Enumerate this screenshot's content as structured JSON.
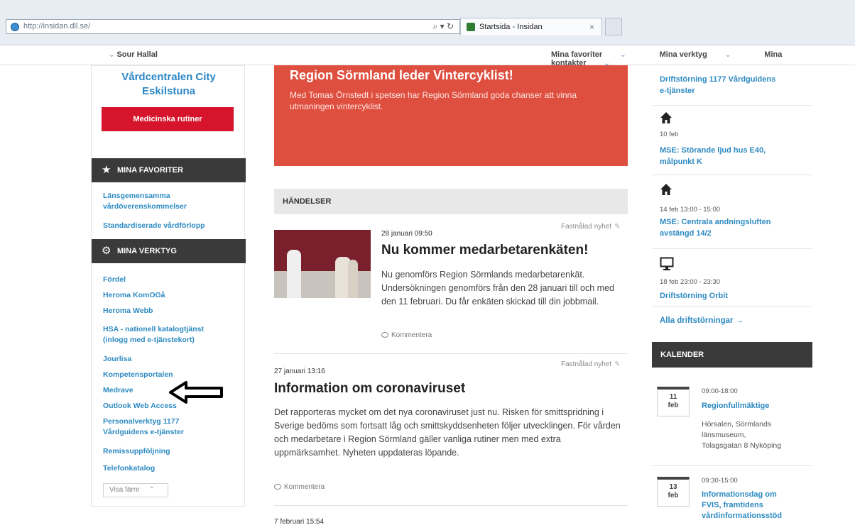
{
  "browser": {
    "url": "http://insidan.dll.se/",
    "tab_title": "Startsida - Insidan",
    "tab_close": "×",
    "address_controls": "⌕ ▾ ↻"
  },
  "topnav": {
    "user": "Sour Hallal",
    "favorites": "Mina favoriter",
    "tools": "Mina verktyg",
    "contacts": "Mina kontakter"
  },
  "left": {
    "unit_title_line1": "Vårdcentralen City",
    "unit_title_line2": "Eskilstuna",
    "red_button": "Medicinska rutiner",
    "favorites_head": "MINA FAVORITER",
    "favorites": [
      "Länsgemensamma",
      "vårdöverenskommelser",
      "Standardiserade vårdförlopp"
    ],
    "tools_head": "MINA VERKTYG",
    "tools": [
      "Fördel",
      "Heroma KomOGå",
      "Heroma Webb",
      "HSA - nationell katalogtjänst",
      "(inlogg med e-tjänstekort)",
      "Jourlisa",
      "Kompetensportalen",
      "Medrave",
      "Outlook Web Access",
      "Personalverktyg 1177",
      "Vårdguidens e-tjänster",
      "Remissuppföljning",
      "Telefonkatalog"
    ],
    "show_less": "Visa färre"
  },
  "banner": {
    "title": "Region Sörmland leder Vintercyklist!",
    "text": "Med Tomas Örnstedt i spetsen har Region Sörmland goda chanser att vinna utmaningen vintercyklist."
  },
  "events": {
    "heading": "HÄNDELSER",
    "pinned_label": "Fastnålad nyhet",
    "comment_label": "Kommentera",
    "items": [
      {
        "date": "28 januari 09:50",
        "title": "Nu kommer medarbetarenkäten!",
        "body": "Nu genomförs Region Sörmlands medarbetarenkät. Undersökningen genomförs från den 28 januari till och med den 11 februari. Du får enkäten skickad till din jobbmail."
      },
      {
        "date": "27 januari 13:16",
        "title": "Information om coronaviruset",
        "body": "Det rapporteras mycket om det nya coronaviruset just nu. Risken för smittspridning i Sverige bedöms som fortsatt låg och smittskyddsenheten följer utvecklingen. För vården och medarbetare i Region Sörmland gäller vanliga rutiner men med extra uppmärksamhet. Nyheten uppdateras löpande."
      },
      {
        "date": "7 februari 15:54"
      }
    ]
  },
  "right": {
    "top_link": "Driftstörning 1177 Vårdguidens",
    "top_link2": "e-tjänster",
    "items": [
      {
        "icon": "home-icon",
        "date": "10 feb",
        "title1": "MSE: Störande ljud hus E40,",
        "title2": "målpunkt K"
      },
      {
        "icon": "home-icon",
        "date": "14 feb 13:00 - 15:00",
        "title1": "MSE: Centrala andningsluften",
        "title2": "avstängd 14/2"
      },
      {
        "icon": "monitor-icon",
        "date": "18 feb 23:00 - 23:30",
        "title1": "Driftstörning Orbit",
        "title2": ""
      }
    ],
    "all_link": "Alla driftstörningar →",
    "calendar_head": "KALENDER",
    "calendar": [
      {
        "day": "11",
        "month": "feb",
        "time": "09:00-18:00",
        "title1": "Regionfullmäktige",
        "title2": "",
        "loc1": "Hörsalen, Sörmlands",
        "loc2": "länsmuseum,",
        "loc3": "Tolagsgatan 8 Nyköping"
      },
      {
        "day": "13",
        "month": "feb",
        "time": "09:30-15:00",
        "title1": "Informationsdag om",
        "title2": "FVIS, framtidens",
        "title3": "vårdinformationsstöd"
      }
    ]
  }
}
